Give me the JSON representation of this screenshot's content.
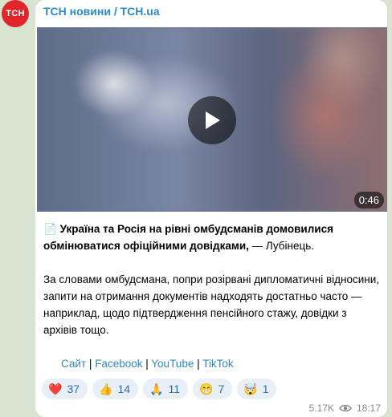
{
  "channel": {
    "avatar_text": "ТСН",
    "name": "ТСН новини / TCH.ua",
    "avatar_color": "#e0262b"
  },
  "video": {
    "duration": "0:46",
    "play_icon": "play-icon"
  },
  "post": {
    "doc_emoji": "📄",
    "headline_bold": "Україна та Росія на рівні омбудсманів домовилися обмінюватися офіційними довідками,",
    "headline_rest": " — Лубінець.",
    "paragraph": "За словами омбудсмана, попри розірвані дипломатичні відносини, запити на отримання документів надходять достатньо часто — наприклад, щодо підтвердження пенсійного стажу, довідки з архівів тощо."
  },
  "links": {
    "site": "Сайт",
    "facebook": "Facebook",
    "youtube": "YouTube",
    "tiktok": "TikTok",
    "sep": "|"
  },
  "reactions": [
    {
      "emoji": "❤️",
      "count": "37"
    },
    {
      "emoji": "👍",
      "count": "14"
    },
    {
      "emoji": "🙏",
      "count": "11"
    },
    {
      "emoji": "😁",
      "count": "7"
    },
    {
      "emoji": "🤯",
      "count": "1"
    }
  ],
  "meta": {
    "views": "5.17K",
    "time": "18:17",
    "views_icon": "eye-icon"
  },
  "colors": {
    "link": "#2f89c6",
    "reaction_bg": "#e9eff6",
    "chat_bg": "#d8e3d0"
  }
}
